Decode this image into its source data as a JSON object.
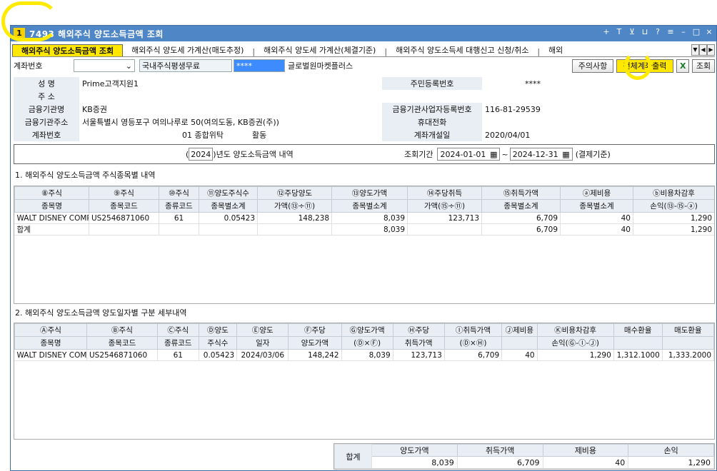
{
  "window": {
    "number": "1",
    "title": "7493 해외주식 양도소득금액 조회",
    "icons": [
      "+",
      "T",
      "⊻",
      "⊔",
      "?",
      "≡",
      "–",
      "□",
      "×"
    ]
  },
  "tabs": [
    {
      "label": "해외주식 양도소득금액 조회",
      "active": true
    },
    {
      "label": "해외주식 양도세 가계산(매도추정)"
    },
    {
      "label": "해외주식 양도세 가계산(체결기준)"
    },
    {
      "label": "해외주식 양도소득세 대행신고 신청/취소"
    },
    {
      "label": "해외"
    }
  ],
  "toolbar": {
    "account_label": "계좌번호",
    "account_value": "",
    "service_label": "국내주식평생무료",
    "masked": "****",
    "product": "글로벌원마켓플러스",
    "notice_btn": "주의사항",
    "print_btn": "전체계좌출력",
    "excel_icon": "X",
    "search_btn": "조회"
  },
  "info": {
    "name_k": "성  명",
    "name_v": "Prime고객지원1",
    "addr_k": "주  소",
    "addr_v": "",
    "rrn_k": "주민등록번호",
    "rrn_v": "****",
    "inst_k": "금융기관명",
    "inst_v": "KB증권",
    "biz_k": "금융기관사업자등록번호",
    "biz_v": "116-81-29539",
    "instaddr_k": "금융기관주소",
    "instaddr_v": "서울특별시 영등포구 여의나루로 50(여의도동, KB증권(주))",
    "mobile_k": "휴대전화",
    "mobile_v": "",
    "acct_k": "계좌번호",
    "acct_v": "01 종합위탁",
    "acct_state": "활동",
    "open_k": "계좌개설일",
    "open_v": "2020/04/01"
  },
  "year": {
    "open_paren": "(",
    "year": "2024",
    "suffix": ")년도 양도소득금액 내역",
    "period_label": "조회기간",
    "from": "2024-01-01",
    "tilde": "~",
    "to": "2024-12-31",
    "basis": "(결제기준)"
  },
  "section1": {
    "title": "1. 해외주식 양도소득금액 주식종목별 내역",
    "head1": [
      "⑧주식",
      "⑨주식",
      "⑩주식",
      "⑪양도주식수",
      "⑫주당양도",
      "⑬양도가액",
      "⑭주당취득",
      "⑮취득가액",
      "ⓐ제비용",
      "ⓑ비용차감후"
    ],
    "head2": [
      "종목명",
      "종목코드",
      "종류코드",
      "종목별소계",
      "가액(⑬÷⑪)",
      "종목별소계",
      "가액(⑮÷⑪)",
      "종목별소계",
      "종목별소계",
      "손익(⑬-⑮-ⓐ)"
    ],
    "rows": [
      [
        "WALT DISNEY COMPA",
        "US2546871060",
        "61",
        "0.05423",
        "148,238",
        "8,039",
        "123,713",
        "6,709",
        "40",
        "1,290"
      ],
      [
        "합계",
        "",
        "",
        "",
        "",
        "8,039",
        "",
        "6,709",
        "40",
        "1,290"
      ]
    ]
  },
  "section2": {
    "title": "2. 해외주식 양도소득금액 양도일자별 구분 세부내역",
    "head1": [
      "Ⓐ주식",
      "Ⓑ주식",
      "Ⓒ주식",
      "Ⓓ양도",
      "Ⓔ양도",
      "Ⓕ주당",
      "Ⓖ양도가액",
      "Ⓗ주당",
      "Ⓘ취득가액",
      "Ⓙ제비용",
      "Ⓚ비용차감후",
      "매수환율",
      "매도환율"
    ],
    "head2": [
      "종목명",
      "종목코드",
      "종류코드",
      "주식수",
      "일자",
      "양도가액",
      "(Ⓓ×Ⓕ)",
      "취득가액",
      "(Ⓓ×Ⓗ)",
      "",
      "손익(Ⓖ-Ⓘ-Ⓙ)",
      "",
      ""
    ],
    "rows": [
      [
        "WALT DISNEY COM",
        "US2546871060",
        "61",
        "0.05423",
        "2024/03/06",
        "148,242",
        "8,039",
        "123,713",
        "6,709",
        "40",
        "1,290",
        "1,312.1000",
        "1,333.2000"
      ]
    ]
  },
  "summary": {
    "label": "합계",
    "heads": [
      "양도가액",
      "취득가액",
      "제비용",
      "손익"
    ],
    "values": [
      "8,039",
      "6,709",
      "40",
      "1,290"
    ]
  }
}
